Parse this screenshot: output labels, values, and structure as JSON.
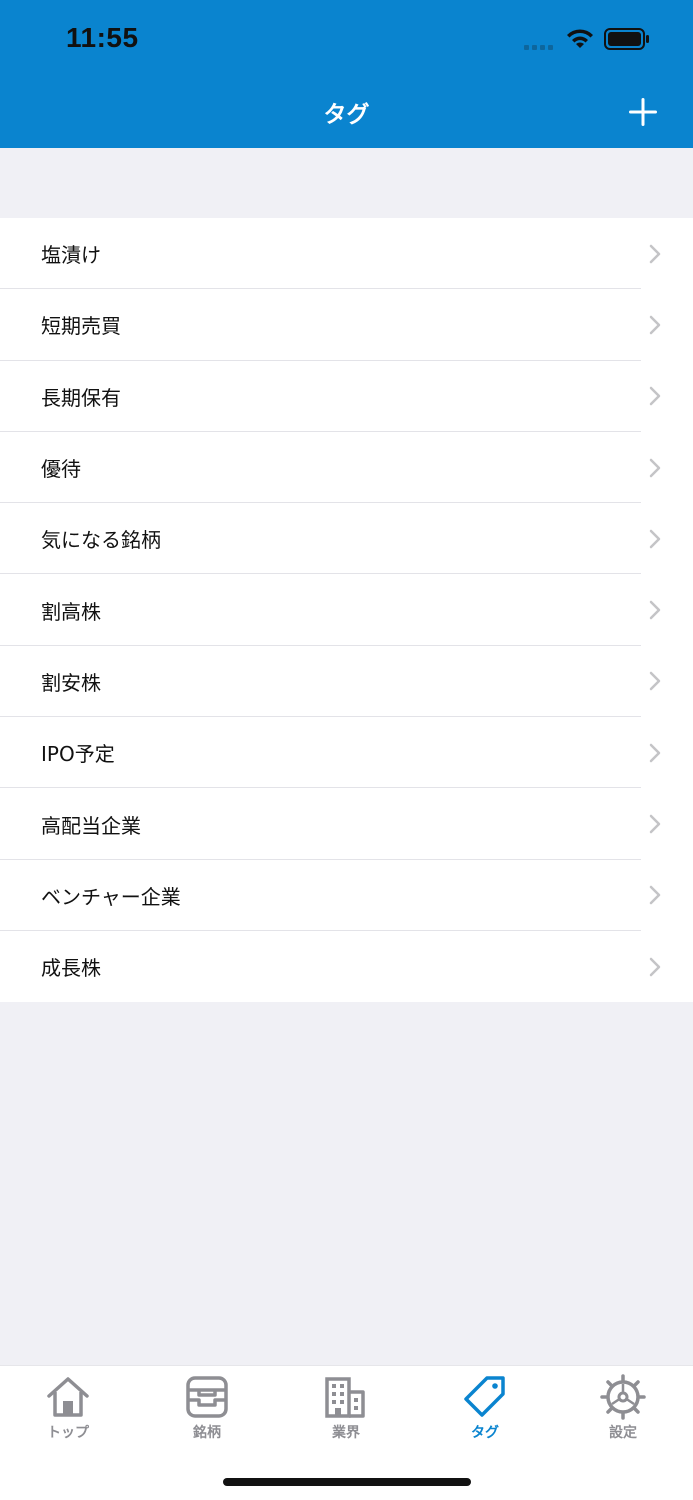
{
  "status_bar": {
    "time": "11:55"
  },
  "nav": {
    "title": "タグ",
    "add_icon": "plus-icon"
  },
  "tags": [
    {
      "label": "塩漬け"
    },
    {
      "label": "短期売買"
    },
    {
      "label": "長期保有"
    },
    {
      "label": "優待"
    },
    {
      "label": "気になる銘柄"
    },
    {
      "label": "割高株"
    },
    {
      "label": "割安株"
    },
    {
      "label": "IPO予定"
    },
    {
      "label": "高配当企業"
    },
    {
      "label": "ベンチャー企業"
    },
    {
      "label": "成長株"
    }
  ],
  "tabbar": {
    "items": [
      {
        "label": "トップ",
        "icon": "home-icon"
      },
      {
        "label": "銘柄",
        "icon": "tray-icon"
      },
      {
        "label": "業界",
        "icon": "building-icon"
      },
      {
        "label": "タグ",
        "icon": "tag-icon"
      },
      {
        "label": "設定",
        "icon": "gear-icon"
      }
    ],
    "active_index": 3
  },
  "colors": {
    "accent": "#0a84cf",
    "background": "#f0f0f5",
    "inactive_tab": "#8e8e93"
  }
}
